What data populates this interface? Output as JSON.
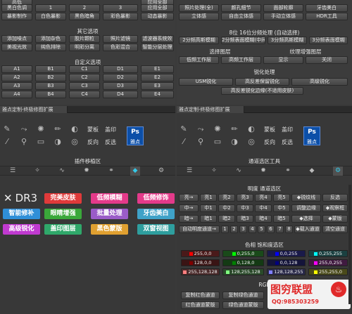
{
  "top_rows": {
    "row1": [
      "高低",
      "",
      "",
      "应用全部"
    ],
    "row2": [
      "黑白色调",
      "1",
      "2",
      "3",
      "应用全部"
    ],
    "row3": [
      "暴影制作",
      "白色暴影",
      "黑色暗角",
      "彩色暴影",
      "动态暴影"
    ]
  },
  "other_options": {
    "title": "其它选项",
    "row1": [
      "添加噪点",
      "添加杂色",
      "胶片颗粒",
      "照片滤镜",
      "滤波器系统效"
    ],
    "row2": [
      "美视光效",
      "纯色排除",
      "明彩分离",
      "色彩混合",
      "智能分层处理"
    ]
  },
  "custom_options": {
    "title": "自定义选项",
    "rows": [
      [
        "A1",
        "B1",
        "C1",
        "D1",
        "E1"
      ],
      [
        "A2",
        "B2",
        "C2",
        "D2",
        "E2"
      ],
      [
        "A3",
        "B3",
        "C3",
        "D3",
        "E3"
      ],
      [
        "A4",
        "B4",
        "C4",
        "D4",
        "E4"
      ]
    ]
  },
  "right_top": {
    "row1": [
      "照片处理(全)",
      "颜孔细节",
      "面部轮廓",
      "牙齿美白"
    ],
    "row2": [
      "立体感",
      "自由立体感",
      "手动立体感",
      "HDR工具"
    ]
  },
  "freq_sep": {
    "title": "8位 16位分频处理 (自动选择)",
    "row": [
      "2分频高斯模糊",
      "2分频表面模糊(中间)",
      "3分频高斯模糊",
      "3分频表面模糊"
    ]
  },
  "layer_select": {
    "title_left": "选择图层",
    "title_right": "纹理增强图层",
    "row": [
      "低频工作层",
      "高频工作层",
      "显示",
      "关闭"
    ]
  },
  "sharpen": {
    "title": "锐化处理",
    "row1": [
      "USM锐化",
      "高反差保留锐化",
      "高级锐化"
    ],
    "row2": "高反差锐化边缘(不适用皮肤)"
  },
  "left_panel": {
    "title": "雅点定制-终极修图扩展",
    "labels": [
      "蒙板",
      "盖印",
      "反向",
      "反选"
    ],
    "ps_logo": [
      "Ps",
      "雅点"
    ],
    "section_title": "插件移植区",
    "logo_text": "DR3",
    "big_buttons": [
      {
        "label": "完美皮肤",
        "color": "#e03a3a"
      },
      {
        "label": "低频模糊",
        "color": "#e43a8a"
      },
      {
        "label": "低频修饰",
        "color": "#e43a8a"
      },
      {
        "label": "智能修补",
        "color": "#2f8fd8"
      },
      {
        "label": "眼睛增强",
        "color": "#3aa83a"
      },
      {
        "label": "批量处理",
        "color": "#9a5cc8"
      },
      {
        "label": "牙齿美白",
        "color": "#3fa2c8"
      },
      {
        "label": "高级锐化",
        "color": "#c03ad0"
      },
      {
        "label": "盖印图层",
        "color": "#2fa86a"
      },
      {
        "label": "黑色蒙版",
        "color": "#e0a030"
      },
      {
        "label": "双窗视图",
        "color": "#2e9e9e"
      }
    ]
  },
  "right_panel": {
    "title": "雅点定制-终极修图扩展",
    "labels": [
      "蒙板",
      "盖印",
      "反向",
      "反选"
    ],
    "ps_logo": [
      "Ps",
      "雅点"
    ],
    "section_title": "通道选区工具",
    "lum_title": "明度 通道选区",
    "lum_rows": [
      [
        "亮→",
        "亮1",
        "亮2",
        "亮3",
        "亮4",
        "亮5",
        "◆锐纹线",
        "反选"
      ],
      [
        "中→",
        "中1",
        "中2",
        "中3",
        "中4",
        "中5",
        "调整边缘",
        "◆观察框"
      ],
      [
        "暗→",
        "暗1",
        "暗2",
        "暗3",
        "暗4",
        "暗5",
        "◆选择",
        "◆蒙版"
      ],
      [
        "自动明度通道→",
        "1",
        "2",
        "3",
        "4",
        "5",
        "6",
        "7",
        "8",
        "◆载入通道",
        "清空通道"
      ]
    ],
    "color_title": "色相 饱和度选区",
    "swatches": [
      {
        "label": "255,0,0",
        "color": "#ff0000"
      },
      {
        "label": "0,255,0",
        "color": "#00ff00"
      },
      {
        "label": "0,0,255",
        "color": "#0000ff"
      },
      {
        "label": "0,255,255",
        "color": "#00ffff"
      },
      {
        "label": "128,0,0",
        "color": "#800000"
      },
      {
        "label": "0,128,0",
        "color": "#008000"
      },
      {
        "label": "0,0,128",
        "color": "#000080"
      },
      {
        "label": "255,0,255",
        "color": "#ff00ff"
      },
      {
        "label": "255,128,128",
        "color": "#ff8080"
      },
      {
        "label": "128,255,128",
        "color": "#80ff80"
      },
      {
        "label": "128,128,255",
        "color": "#8080ff"
      },
      {
        "label": "255,255,0",
        "color": "#ffff00"
      }
    ],
    "rgb_title": "RGB",
    "rgb_rows": [
      [
        "复制红色通道",
        "复制绿色通道"
      ],
      [
        "红色通道蒙版",
        "绿色通道蒙版"
      ]
    ],
    "watermark": {
      "name": "图穷联盟",
      "qq": "QQ:985303259"
    }
  }
}
